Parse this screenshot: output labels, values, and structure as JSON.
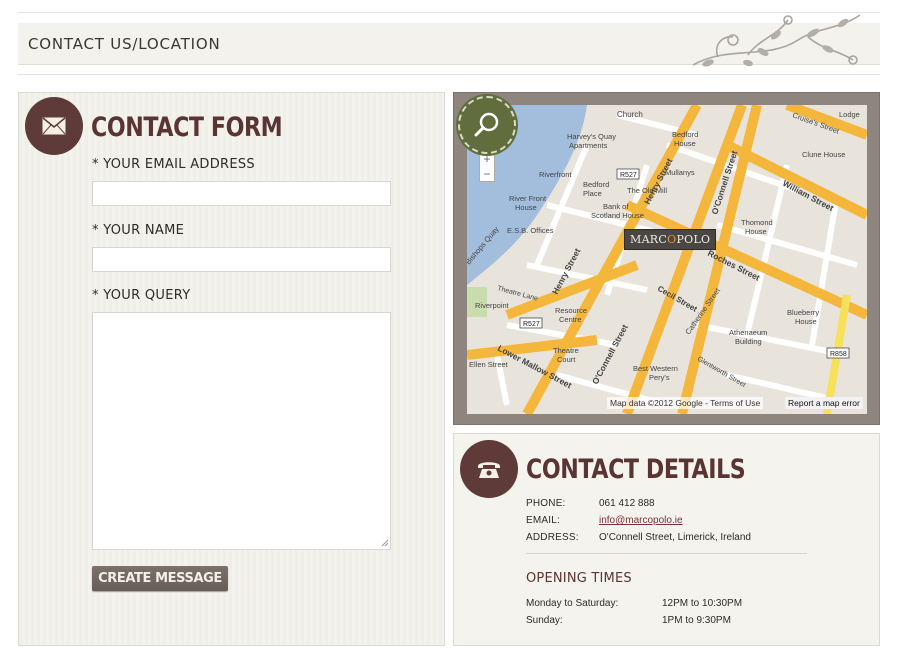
{
  "page": {
    "title": "CONTACT US/LOCATION"
  },
  "contact_form": {
    "title": "CONTACT FORM",
    "email_label": "* YOUR EMAIL ADDRESS",
    "email_value": "",
    "name_label": "* YOUR NAME",
    "name_value": "",
    "query_label": "* YOUR QUERY",
    "query_value": "",
    "submit_label": "CREATE MESSAGE"
  },
  "map": {
    "marker_prefix": "MARC",
    "marker_accent": "O",
    "marker_suffix": "POLO",
    "zoom_in": "+",
    "zoom_out": "−",
    "attribution": "Map data ©2012 Google - Terms of Use",
    "report_label": "Report a map error",
    "labels": [
      "Church",
      "Harvey's Quay Apartments",
      "Bedford House",
      "Lodge",
      "Cruise's Street",
      "Clune House",
      "William Street",
      "Riverfront",
      "Bedford Place",
      "The Old Mill",
      "Mullanys",
      "Thomond House",
      "River Front House",
      "Bank of Scotland House",
      "E.S.B. Offices",
      "Henry Street",
      "O'Connell Street",
      "Roches Street",
      "Cecil Street",
      "Catherine Street",
      "Athenaeum Building",
      "Blueberry House",
      "Riverpoint",
      "Theatre Lane",
      "Resource Centre",
      "Theatre Court",
      "Lower Mallow Street",
      "Best Western Pery's",
      "Glentworth Street",
      "R527",
      "R858",
      "Bishops Quay",
      "Ellen Street"
    ]
  },
  "contact_details": {
    "title": "CONTACT DETAILS",
    "phone_label": "PHONE:",
    "phone_value": "061 412 888",
    "email_label": "EMAIL:",
    "email_value": "info@marcopolo.ie",
    "address_label": "ADDRESS:",
    "address_value": "O'Connell Street, Limerick, Ireland",
    "opening_title": "OPENING TIMES",
    "hours": [
      {
        "day": "Monday to Saturday:",
        "time": "12PM to 10:30PM"
      },
      {
        "day": "Sunday:",
        "time": "1PM to 9:30PM"
      }
    ]
  },
  "icons": {
    "envelope": "envelope-icon",
    "magnifier": "search-icon",
    "telephone": "phone-icon",
    "vine": "vine-ornament"
  },
  "colors": {
    "accent": "#5a3432",
    "map_badge": "#616d3c",
    "button": "#6f665f",
    "email_link": "#7a2f3a",
    "road": "#f5b63c",
    "water": "#9fb8d8"
  }
}
